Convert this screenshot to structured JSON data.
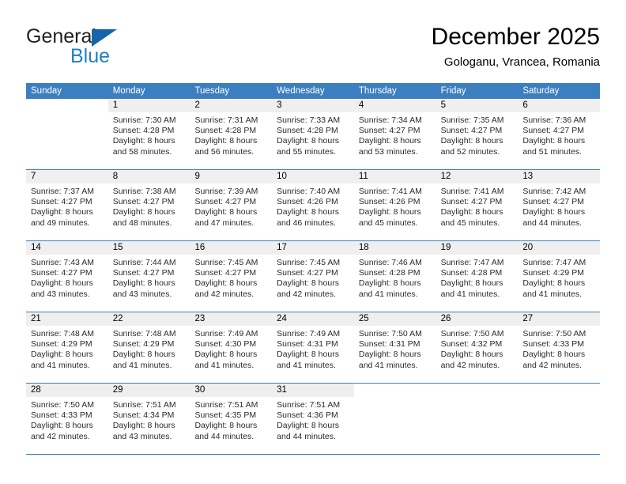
{
  "logo": {
    "word_primary": "General",
    "word_secondary": "Blue",
    "triangle_color": "#1464aa",
    "secondary_color": "#1f7fc4"
  },
  "header": {
    "title": "December 2025",
    "location": "Gologanu, Vrancea, Romania"
  },
  "theme": {
    "header_blue": "#3c7fc0",
    "day_band_gray": "#efefef",
    "cell_white": "#ffffff"
  },
  "weekdays": [
    "Sunday",
    "Monday",
    "Tuesday",
    "Wednesday",
    "Thursday",
    "Friday",
    "Saturday"
  ],
  "weeks": [
    [
      {
        "day": "",
        "sunrise": "",
        "sunset": "",
        "daylight_line1": "",
        "daylight_line2": ""
      },
      {
        "day": "1",
        "sunrise": "Sunrise: 7:30 AM",
        "sunset": "Sunset: 4:28 PM",
        "daylight_line1": "Daylight: 8 hours",
        "daylight_line2": "and 58 minutes."
      },
      {
        "day": "2",
        "sunrise": "Sunrise: 7:31 AM",
        "sunset": "Sunset: 4:28 PM",
        "daylight_line1": "Daylight: 8 hours",
        "daylight_line2": "and 56 minutes."
      },
      {
        "day": "3",
        "sunrise": "Sunrise: 7:33 AM",
        "sunset": "Sunset: 4:28 PM",
        "daylight_line1": "Daylight: 8 hours",
        "daylight_line2": "and 55 minutes."
      },
      {
        "day": "4",
        "sunrise": "Sunrise: 7:34 AM",
        "sunset": "Sunset: 4:27 PM",
        "daylight_line1": "Daylight: 8 hours",
        "daylight_line2": "and 53 minutes."
      },
      {
        "day": "5",
        "sunrise": "Sunrise: 7:35 AM",
        "sunset": "Sunset: 4:27 PM",
        "daylight_line1": "Daylight: 8 hours",
        "daylight_line2": "and 52 minutes."
      },
      {
        "day": "6",
        "sunrise": "Sunrise: 7:36 AM",
        "sunset": "Sunset: 4:27 PM",
        "daylight_line1": "Daylight: 8 hours",
        "daylight_line2": "and 51 minutes."
      }
    ],
    [
      {
        "day": "7",
        "sunrise": "Sunrise: 7:37 AM",
        "sunset": "Sunset: 4:27 PM",
        "daylight_line1": "Daylight: 8 hours",
        "daylight_line2": "and 49 minutes."
      },
      {
        "day": "8",
        "sunrise": "Sunrise: 7:38 AM",
        "sunset": "Sunset: 4:27 PM",
        "daylight_line1": "Daylight: 8 hours",
        "daylight_line2": "and 48 minutes."
      },
      {
        "day": "9",
        "sunrise": "Sunrise: 7:39 AM",
        "sunset": "Sunset: 4:27 PM",
        "daylight_line1": "Daylight: 8 hours",
        "daylight_line2": "and 47 minutes."
      },
      {
        "day": "10",
        "sunrise": "Sunrise: 7:40 AM",
        "sunset": "Sunset: 4:26 PM",
        "daylight_line1": "Daylight: 8 hours",
        "daylight_line2": "and 46 minutes."
      },
      {
        "day": "11",
        "sunrise": "Sunrise: 7:41 AM",
        "sunset": "Sunset: 4:26 PM",
        "daylight_line1": "Daylight: 8 hours",
        "daylight_line2": "and 45 minutes."
      },
      {
        "day": "12",
        "sunrise": "Sunrise: 7:41 AM",
        "sunset": "Sunset: 4:27 PM",
        "daylight_line1": "Daylight: 8 hours",
        "daylight_line2": "and 45 minutes."
      },
      {
        "day": "13",
        "sunrise": "Sunrise: 7:42 AM",
        "sunset": "Sunset: 4:27 PM",
        "daylight_line1": "Daylight: 8 hours",
        "daylight_line2": "and 44 minutes."
      }
    ],
    [
      {
        "day": "14",
        "sunrise": "Sunrise: 7:43 AM",
        "sunset": "Sunset: 4:27 PM",
        "daylight_line1": "Daylight: 8 hours",
        "daylight_line2": "and 43 minutes."
      },
      {
        "day": "15",
        "sunrise": "Sunrise: 7:44 AM",
        "sunset": "Sunset: 4:27 PM",
        "daylight_line1": "Daylight: 8 hours",
        "daylight_line2": "and 43 minutes."
      },
      {
        "day": "16",
        "sunrise": "Sunrise: 7:45 AM",
        "sunset": "Sunset: 4:27 PM",
        "daylight_line1": "Daylight: 8 hours",
        "daylight_line2": "and 42 minutes."
      },
      {
        "day": "17",
        "sunrise": "Sunrise: 7:45 AM",
        "sunset": "Sunset: 4:27 PM",
        "daylight_line1": "Daylight: 8 hours",
        "daylight_line2": "and 42 minutes."
      },
      {
        "day": "18",
        "sunrise": "Sunrise: 7:46 AM",
        "sunset": "Sunset: 4:28 PM",
        "daylight_line1": "Daylight: 8 hours",
        "daylight_line2": "and 41 minutes."
      },
      {
        "day": "19",
        "sunrise": "Sunrise: 7:47 AM",
        "sunset": "Sunset: 4:28 PM",
        "daylight_line1": "Daylight: 8 hours",
        "daylight_line2": "and 41 minutes."
      },
      {
        "day": "20",
        "sunrise": "Sunrise: 7:47 AM",
        "sunset": "Sunset: 4:29 PM",
        "daylight_line1": "Daylight: 8 hours",
        "daylight_line2": "and 41 minutes."
      }
    ],
    [
      {
        "day": "21",
        "sunrise": "Sunrise: 7:48 AM",
        "sunset": "Sunset: 4:29 PM",
        "daylight_line1": "Daylight: 8 hours",
        "daylight_line2": "and 41 minutes."
      },
      {
        "day": "22",
        "sunrise": "Sunrise: 7:48 AM",
        "sunset": "Sunset: 4:29 PM",
        "daylight_line1": "Daylight: 8 hours",
        "daylight_line2": "and 41 minutes."
      },
      {
        "day": "23",
        "sunrise": "Sunrise: 7:49 AM",
        "sunset": "Sunset: 4:30 PM",
        "daylight_line1": "Daylight: 8 hours",
        "daylight_line2": "and 41 minutes."
      },
      {
        "day": "24",
        "sunrise": "Sunrise: 7:49 AM",
        "sunset": "Sunset: 4:31 PM",
        "daylight_line1": "Daylight: 8 hours",
        "daylight_line2": "and 41 minutes."
      },
      {
        "day": "25",
        "sunrise": "Sunrise: 7:50 AM",
        "sunset": "Sunset: 4:31 PM",
        "daylight_line1": "Daylight: 8 hours",
        "daylight_line2": "and 41 minutes."
      },
      {
        "day": "26",
        "sunrise": "Sunrise: 7:50 AM",
        "sunset": "Sunset: 4:32 PM",
        "daylight_line1": "Daylight: 8 hours",
        "daylight_line2": "and 42 minutes."
      },
      {
        "day": "27",
        "sunrise": "Sunrise: 7:50 AM",
        "sunset": "Sunset: 4:33 PM",
        "daylight_line1": "Daylight: 8 hours",
        "daylight_line2": "and 42 minutes."
      }
    ],
    [
      {
        "day": "28",
        "sunrise": "Sunrise: 7:50 AM",
        "sunset": "Sunset: 4:33 PM",
        "daylight_line1": "Daylight: 8 hours",
        "daylight_line2": "and 42 minutes."
      },
      {
        "day": "29",
        "sunrise": "Sunrise: 7:51 AM",
        "sunset": "Sunset: 4:34 PM",
        "daylight_line1": "Daylight: 8 hours",
        "daylight_line2": "and 43 minutes."
      },
      {
        "day": "30",
        "sunrise": "Sunrise: 7:51 AM",
        "sunset": "Sunset: 4:35 PM",
        "daylight_line1": "Daylight: 8 hours",
        "daylight_line2": "and 44 minutes."
      },
      {
        "day": "31",
        "sunrise": "Sunrise: 7:51 AM",
        "sunset": "Sunset: 4:36 PM",
        "daylight_line1": "Daylight: 8 hours",
        "daylight_line2": "and 44 minutes."
      },
      {
        "day": "",
        "sunrise": "",
        "sunset": "",
        "daylight_line1": "",
        "daylight_line2": ""
      },
      {
        "day": "",
        "sunrise": "",
        "sunset": "",
        "daylight_line1": "",
        "daylight_line2": ""
      },
      {
        "day": "",
        "sunrise": "",
        "sunset": "",
        "daylight_line1": "",
        "daylight_line2": ""
      }
    ]
  ]
}
